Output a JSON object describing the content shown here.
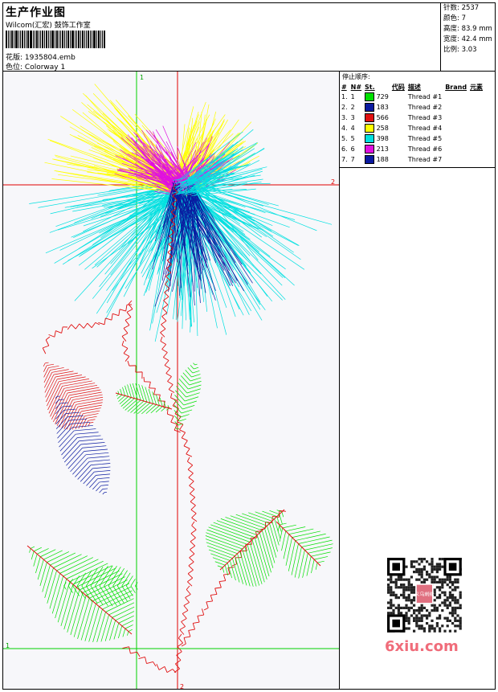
{
  "header": {
    "title": "生产作业图",
    "company": "Wilcom(汇宏) 鼓饰工作室",
    "design_label": "花版:",
    "design_value": "1935804.emb",
    "colorway_label": "色位:",
    "colorway_value": "Colorway 1"
  },
  "stats": [
    {
      "label": "针数:",
      "value": "2537"
    },
    {
      "label": "颜色:",
      "value": "7"
    },
    {
      "label": "高度:",
      "value": "83.9 mm"
    },
    {
      "label": "宽度:",
      "value": "42.4 mm"
    },
    {
      "label": "比例:",
      "value": "3.03"
    }
  ],
  "sequence": {
    "title": "停止顺序:",
    "columns": [
      "#",
      "N#",
      "St.",
      "代码",
      "描述",
      "Brand",
      "元素"
    ],
    "rows": [
      {
        "num": "1.",
        "n": "1",
        "color": "#00e000",
        "st": "729",
        "desc": "Thread #1"
      },
      {
        "num": "2.",
        "n": "2",
        "color": "#0a1aa0",
        "st": "183",
        "desc": "Thread #2"
      },
      {
        "num": "3.",
        "n": "3",
        "color": "#e01010",
        "st": "566",
        "desc": "Thread #3"
      },
      {
        "num": "4.",
        "n": "4",
        "color": "#ffff00",
        "st": "258",
        "desc": "Thread #4"
      },
      {
        "num": "5.",
        "n": "5",
        "color": "#00e0e0",
        "st": "398",
        "desc": "Thread #5"
      },
      {
        "num": "6.",
        "n": "6",
        "color": "#e010e0",
        "st": "213",
        "desc": "Thread #6"
      },
      {
        "num": "7.",
        "n": "7",
        "color": "#0a1aa0",
        "st": "188",
        "desc": "Thread #7"
      }
    ]
  },
  "guides": {
    "v_green_label": "1",
    "v_red_label": "2",
    "h_red_label": "2",
    "h_green_label": "1",
    "v_red_bottom_label": "2"
  },
  "watermark": "6xiu.com",
  "qr_badge": "义乌刺绣"
}
